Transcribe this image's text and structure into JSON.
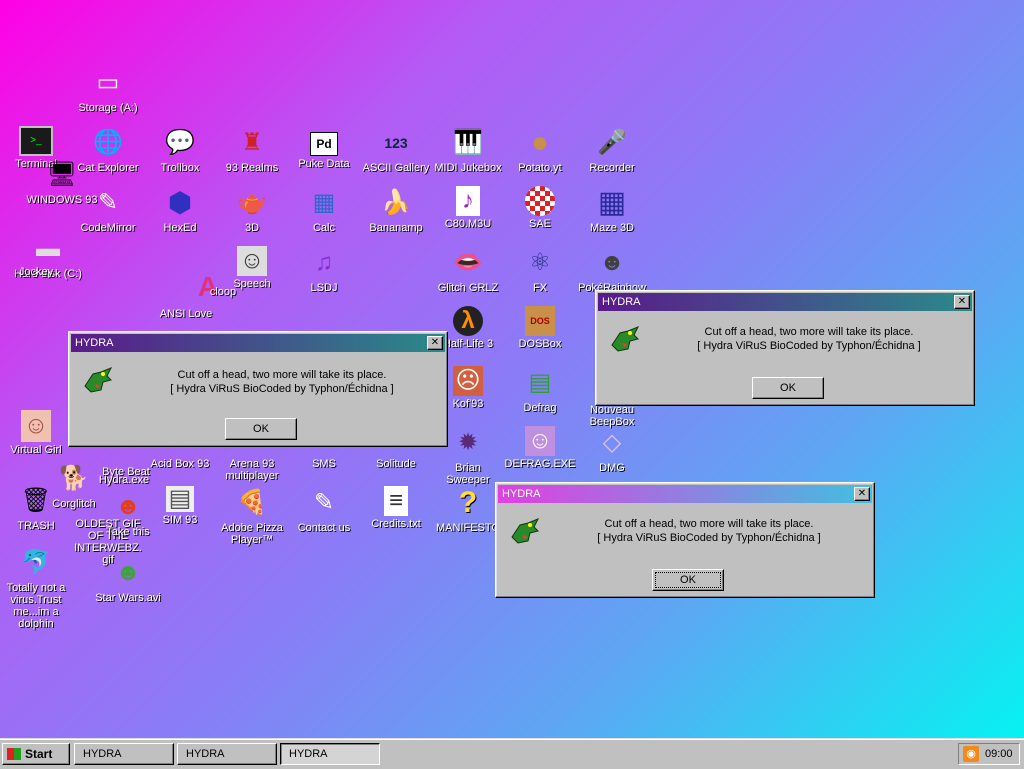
{
  "desktop_icons": [
    {
      "label": "Storage (A:)",
      "icon": "floppy-drive-icon",
      "glyph": "▭",
      "color": "#ffffff"
    },
    {
      "label": "Terminal",
      "icon": "terminal-icon",
      "glyph": "▮",
      "color": "#222222"
    },
    {
      "label": "Cat Explorer",
      "icon": "globe-cat-icon",
      "glyph": "🌐",
      "color": "#2a8a2a"
    },
    {
      "label": "Trollbox",
      "icon": "chat-icon",
      "glyph": "💬",
      "color": "#ffd23a"
    },
    {
      "label": "93 Realms",
      "icon": "character-icon",
      "glyph": "♜",
      "color": "#cc2222"
    },
    {
      "label": "Puke Data",
      "icon": "pd-icon",
      "glyph": "Pd",
      "color": "#000000"
    },
    {
      "label": "ASCII Gallery",
      "icon": "ascii-icon",
      "glyph": "123",
      "color": "#3aa0e0"
    },
    {
      "label": "MIDI Jukebox",
      "icon": "piano-icon",
      "glyph": "🎹",
      "color": "#222222"
    },
    {
      "label": "Potato.yt",
      "icon": "potato-icon",
      "glyph": "●",
      "color": "#c89048"
    },
    {
      "label": "Recorder",
      "icon": "microphone-icon",
      "glyph": "🎤",
      "color": "#666666"
    },
    {
      "label": "WINDOWS 93",
      "icon": "computer-icon",
      "glyph": "🖥",
      "color": "#808080"
    },
    {
      "label": "CodeMirror",
      "icon": "codemirror-icon",
      "glyph": "✎",
      "color": "#ffffff"
    },
    {
      "label": "HexEd",
      "icon": "cube-icon",
      "glyph": "⬢",
      "color": "#3030c0"
    },
    {
      "label": "3D",
      "icon": "teapot-icon",
      "glyph": "🫖",
      "color": "#e0a0a0"
    },
    {
      "label": "Calc",
      "icon": "calculator-icon",
      "glyph": "▦",
      "color": "#2a6acc"
    },
    {
      "label": "Bananamp",
      "icon": "banana-icon",
      "glyph": "🍌",
      "color": "#ffdd33"
    },
    {
      "label": "C80.M3U",
      "icon": "audio-file-icon",
      "glyph": "♪",
      "color": "#ffffff"
    },
    {
      "label": "SAE",
      "icon": "boing-ball-icon",
      "glyph": "●",
      "color": "#e02020"
    },
    {
      "label": "Maze 3D",
      "icon": "maze-icon",
      "glyph": "▦",
      "color": "#2a2a9a"
    },
    {
      "label": "Hard disk (C:)",
      "icon": "hard-disk-icon",
      "glyph": "▬",
      "color": "#c0c0c0"
    },
    {
      "label": "Jockey",
      "icon": "pony-icon",
      "glyph": "🦄",
      "color": "#c060e0"
    },
    {
      "label": "Speech",
      "icon": "face-icon",
      "glyph": "☺",
      "color": "#d0d0d0"
    },
    {
      "label": "LSDJ",
      "icon": "lsdj-icon",
      "glyph": "♫",
      "color": "#8a2ad0"
    },
    {
      "label": "Glitch GRLZ",
      "icon": "lips-icon",
      "glyph": "👄",
      "color": "#e02040"
    },
    {
      "label": "FX",
      "icon": "atom-icon",
      "glyph": "⚛",
      "color": "#203080"
    },
    {
      "label": "PokéRainbow",
      "icon": "pokemon-icon",
      "glyph": "☻",
      "color": "#404040"
    },
    {
      "label": "cloop",
      "icon": "letter-a-icon",
      "glyph": "A",
      "color": "#e03080"
    },
    {
      "label": "ANSI Love",
      "icon": "ansi-icon",
      "glyph": "♥",
      "color": "#ff4090"
    },
    {
      "label": "Half-Life 3",
      "icon": "lambda-icon",
      "glyph": "λ",
      "color": "#ff8c00"
    },
    {
      "label": "DOSBox",
      "icon": "dosbox-icon",
      "glyph": "▣",
      "color": "#c89048"
    },
    {
      "label": "Kof'93",
      "icon": "fighter-icon",
      "glyph": "☹",
      "color": "#d06040"
    },
    {
      "label": "Defrag",
      "icon": "defrag-icon",
      "glyph": "▤",
      "color": "#30a030"
    },
    {
      "label": "Virtual Girl",
      "icon": "girl-portrait-icon",
      "glyph": "☺",
      "color": "#f0b0a0"
    },
    {
      "label": "Corglitch",
      "icon": "corgi-icon",
      "glyph": "🐕",
      "color": "#e09040"
    },
    {
      "label": "Byte Beat",
      "icon": "byte-beat-icon",
      "glyph": "♪",
      "color": "#30a030"
    },
    {
      "label": "Acid Box 93",
      "icon": "acid-icon",
      "glyph": "☻",
      "color": "#ffdd33"
    },
    {
      "label": "Arena 93 multiplayer",
      "icon": "arena-icon",
      "glyph": "◆",
      "color": "#3060c0"
    },
    {
      "label": "SMS",
      "icon": "sms-icon",
      "glyph": "✉",
      "color": "#808080"
    },
    {
      "label": "Solitude",
      "icon": "solitude-icon",
      "glyph": "♠",
      "color": "#2a2a2a"
    },
    {
      "label": "Brian Sweeper",
      "icon": "mine-icon",
      "glyph": "✹",
      "color": "#5a2a7a"
    },
    {
      "label": "DEFRAG.EXE",
      "icon": "ghost-face-icon",
      "glyph": "☺",
      "color": "#8a2ad0"
    },
    {
      "label": "DMG",
      "icon": "dmg-icon",
      "glyph": "◇",
      "color": "#c080d0"
    },
    {
      "label": "Nouveau BeepBox",
      "icon": "beepbox-icon",
      "glyph": "■",
      "color": "#ffffff"
    },
    {
      "label": "TRASH",
      "icon": "trash-icon",
      "glyph": "🗑",
      "color": "#c0c0c0"
    },
    {
      "label": "OLDEST GIF OF THE INTERWEBZ.gif",
      "icon": "gif-icon",
      "glyph": "▶",
      "color": "#ffffff"
    },
    {
      "label": "Take this",
      "icon": "clown-icon",
      "glyph": "☻",
      "color": "#e04020"
    },
    {
      "label": "SIM 93",
      "icon": "sim-icon",
      "glyph": "▤",
      "color": "#606060"
    },
    {
      "label": "Adobe Pizza Player™",
      "icon": "pizza-icon",
      "glyph": "🍕",
      "color": "#d08030"
    },
    {
      "label": "Contact us",
      "icon": "contact-icon",
      "glyph": "✎",
      "color": "#ffffff"
    },
    {
      "label": "Credits.txt",
      "icon": "text-file-icon",
      "glyph": "≡",
      "color": "#ffffff"
    },
    {
      "label": "MANIFESTO",
      "icon": "question-icon",
      "glyph": "?",
      "color": "#ffdd33"
    },
    {
      "label": "Totally not a virus.Trust me...im a dolphin",
      "icon": "dolphin-icon",
      "glyph": "🐬",
      "color": "#40a0d0"
    },
    {
      "label": "Star Wars.avi",
      "icon": "yoda-icon",
      "glyph": "☻",
      "color": "#40a040"
    },
    {
      "label": "Hydra.exe",
      "icon": "hydra-icon",
      "glyph": "🐉",
      "color": "#2a8a2a"
    }
  ],
  "dialogs": [
    {
      "title": "HYDRA",
      "message": "Cut off a head, two more will take its place.",
      "credit": "[ Hydra ViRuS BioCoded by Typhon/Échidna ]",
      "ok": "OK",
      "icon": "hydra-dragon-icon"
    },
    {
      "title": "HYDRA",
      "message": "Cut off a head, two more will take its place.",
      "credit": "[ Hydra ViRuS BioCoded by Typhon/Échidna ]",
      "ok": "OK",
      "icon": "hydra-dragon-icon"
    },
    {
      "title": "HYDRA",
      "message": "Cut off a head, two more will take its place.",
      "credit": "[ Hydra ViRuS BioCoded by Typhon/Échidna ]",
      "ok": "OK",
      "icon": "hydra-dragon-icon"
    }
  ],
  "taskbar": {
    "start_label": "Start",
    "tasks": [
      {
        "label": "HYDRA"
      },
      {
        "label": "HYDRA"
      },
      {
        "label": "HYDRA"
      }
    ],
    "clock": "09:00",
    "tray_icon": "rss-icon"
  }
}
